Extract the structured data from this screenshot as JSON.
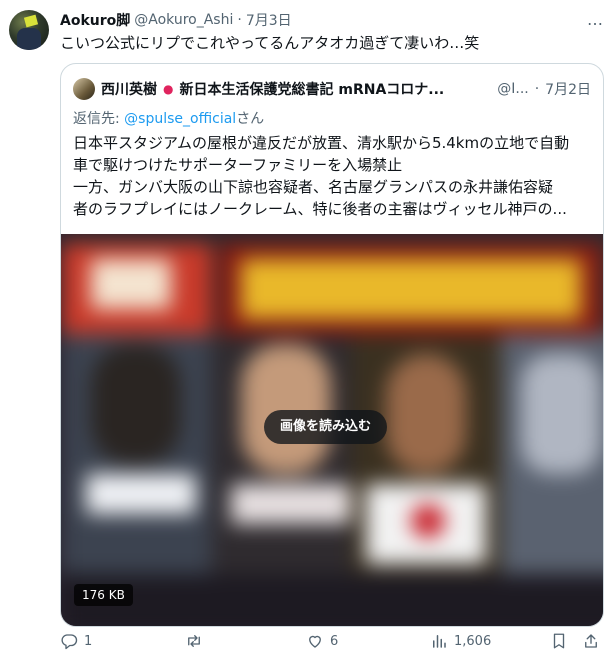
{
  "tweet": {
    "display_name": "Aokuro脚",
    "handle": "@Aokuro_Ashi",
    "separator": "·",
    "date": "7月3日",
    "more": "…",
    "text": "こいつ公式にリプでこれやってるんアタオカ過ぎて凄いわ…笑"
  },
  "quote": {
    "display_name": "西川英樹",
    "status_dot": "●",
    "title": "新日本生活保護党総書記 mRNAコロナ...",
    "handle": "@I...",
    "separator": "·",
    "date": "7月2日",
    "reply_prefix": "返信先: ",
    "reply_mention": "@spulse_official",
    "reply_suffix": "さん",
    "lines": [
      "日本平スタジアムの屋根が違反だが放置、清水駅から5.4kmの立地で自動",
      "車で駆けつけたサポーターファミリーを入場禁止",
      "一方、ガンバ大阪の山下諒也容疑者、名古屋グランパスの永井謙佑容疑",
      "者のラフプレイにはノークレーム、特に後者の主審はヴィッセル神戸の..."
    ],
    "media": {
      "load_label": "画像を読み込む",
      "size_label": "176 KB"
    }
  },
  "actions": {
    "replies": "1",
    "retweets": "",
    "likes": "6",
    "views": "1,606"
  },
  "colors": {
    "link": "#1d9bf0",
    "muted": "#536471",
    "text": "#0f1419",
    "border": "#cfd9de"
  }
}
